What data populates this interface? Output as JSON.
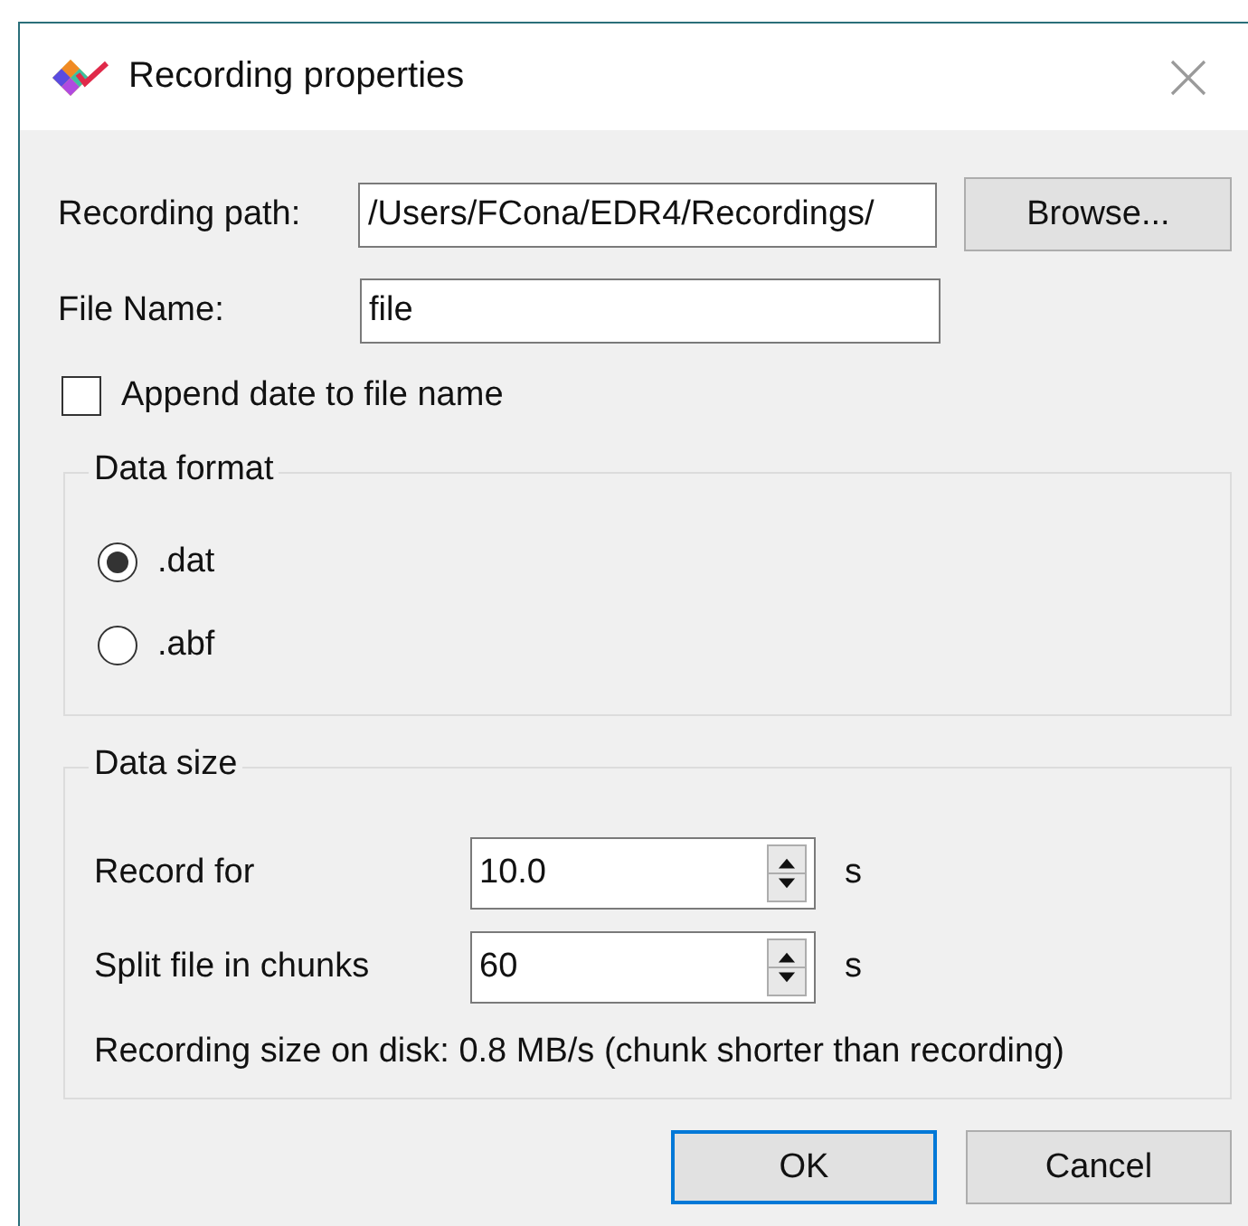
{
  "window": {
    "title": "Recording properties"
  },
  "recording_path": {
    "label": "Recording path:",
    "value": "/Users/FCona/EDR4/Recordings/",
    "button": "Browse..."
  },
  "file_name": {
    "label": "File Name:",
    "value": "file"
  },
  "append_date": {
    "label": "Append date to file name",
    "checked": false
  },
  "data_format": {
    "title": "Data format",
    "options": [
      {
        "label": ".dat",
        "selected": true
      },
      {
        "label": ".abf",
        "selected": false
      }
    ]
  },
  "data_size": {
    "title": "Data size",
    "fields": [
      {
        "label": "Record for",
        "value": "10.0",
        "unit": "s"
      },
      {
        "label": "Split file in chunks",
        "value": "60",
        "unit": "s"
      }
    ],
    "info": "Recording size on disk: 0.8 MB/s (chunk shorter than recording)"
  },
  "buttons": [
    {
      "label": "OK",
      "default": true
    },
    {
      "label": "Cancel",
      "default": false
    }
  ]
}
